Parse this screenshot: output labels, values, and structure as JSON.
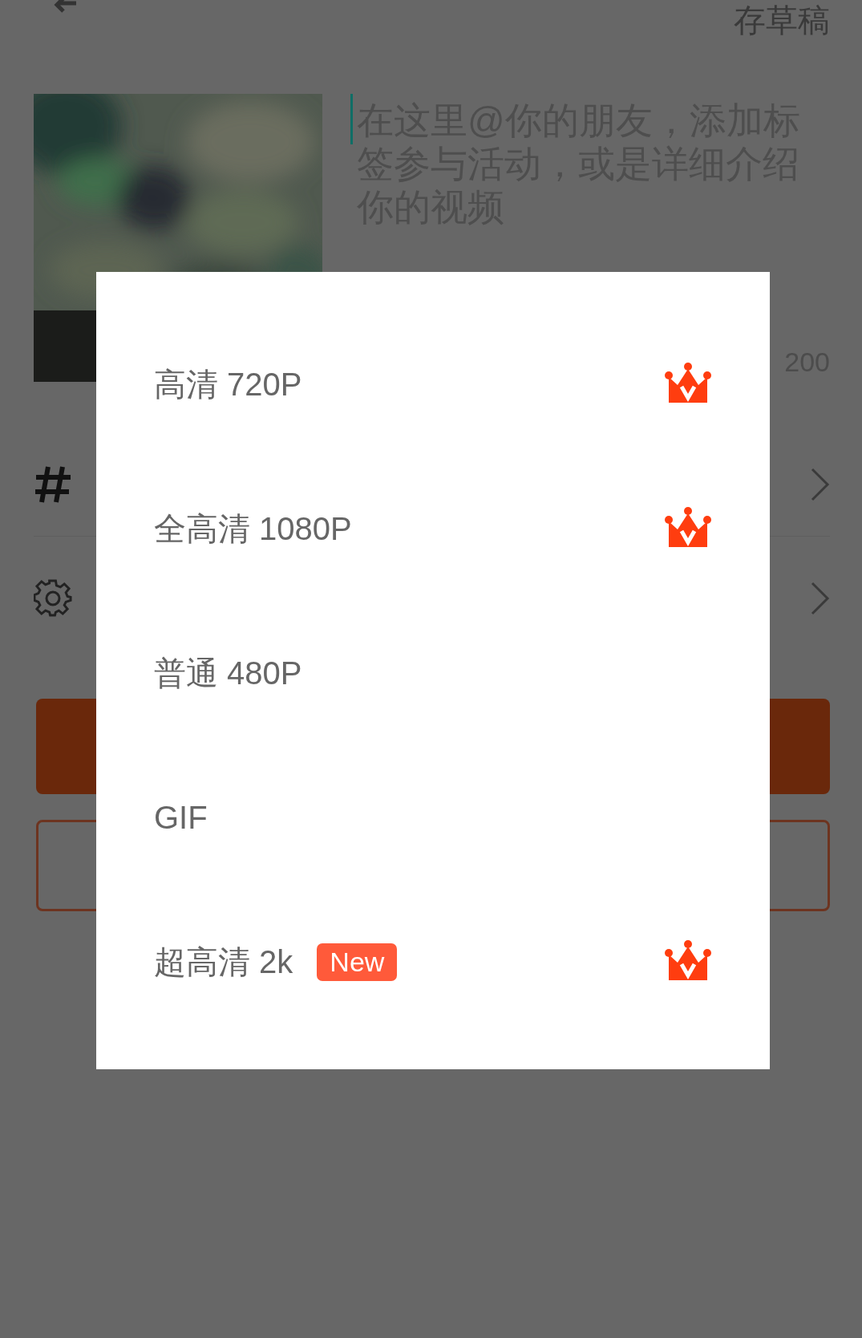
{
  "header": {
    "save_draft": "存草稿"
  },
  "description": {
    "placeholder": "在这里@你的朋友，添加标签参与活动，或是详细介绍你的视频",
    "counter": "200"
  },
  "quality_dialog": {
    "options": [
      {
        "label": "高清 720P",
        "vip": true
      },
      {
        "label": "全高清 1080P",
        "vip": true
      },
      {
        "label": "普通 480P",
        "vip": false
      },
      {
        "label": "GIF",
        "vip": false
      },
      {
        "label": "超高清 2k",
        "badge": "New",
        "vip": true
      }
    ]
  }
}
